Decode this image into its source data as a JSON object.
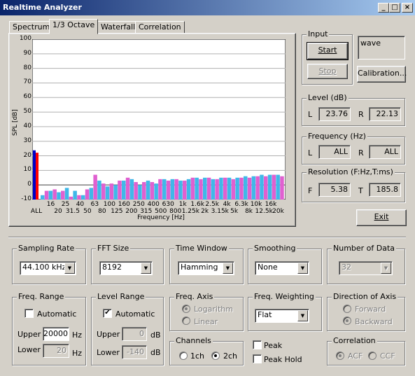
{
  "window": {
    "title": "Realtime Analyzer"
  },
  "tabs": [
    {
      "label": "Spectrum",
      "active": false
    },
    {
      "label": "1/3 Octave",
      "active": true
    },
    {
      "label": "Waterfall",
      "active": false
    },
    {
      "label": "Correlation",
      "active": false
    }
  ],
  "chart_data": {
    "type": "bar",
    "ylabel": "SPL [dB]",
    "xlabel": "Frequency [Hz]",
    "ylim": [
      -10,
      100
    ],
    "yticks": [
      100,
      90,
      80,
      70,
      60,
      50,
      40,
      30,
      20,
      10,
      0,
      -10
    ],
    "xticks_row1": [
      "16",
      "25",
      "40",
      "63",
      "100",
      "160",
      "250",
      "400",
      "630",
      "1k",
      "1.6k",
      "2.5k",
      "4k",
      "6.3k",
      "10k",
      "16k"
    ],
    "xticks_row2": [
      "ALL",
      "20",
      "31.5",
      "50",
      "80",
      "125",
      "200",
      "315",
      "500",
      "800",
      "1.25k",
      "2k",
      "3.15k",
      "5k",
      "8k",
      "12.5k",
      "20k"
    ],
    "all_bars": {
      "L": 23.76,
      "R": 22.13,
      "colors": [
        "#0000c8",
        "#ff0000"
      ]
    },
    "series": [
      {
        "color": "#40b8e8",
        "values": [
          -7,
          -4,
          -5,
          -2,
          -4,
          -7,
          -2,
          3,
          -1,
          0,
          3,
          4,
          0,
          3,
          1,
          4,
          4,
          3,
          4,
          5,
          5,
          4,
          5,
          5,
          5,
          6,
          6,
          7,
          7,
          7
        ]
      },
      {
        "color": "#e060d0",
        "values": [
          -4,
          -3,
          -4,
          -8,
          -7,
          -3,
          7,
          1,
          1,
          3,
          5,
          2,
          2,
          2,
          4,
          3,
          4,
          3,
          5,
          4,
          5,
          4,
          5,
          4,
          5,
          5,
          6,
          6,
          7,
          6
        ]
      }
    ]
  },
  "input": {
    "label": "Input",
    "start": "Start",
    "stop": "Stop",
    "source": "wave",
    "calibration": "Calibration..."
  },
  "level": {
    "label": "Level (dB)",
    "l_label": "L",
    "l_value": "23.76",
    "r_label": "R",
    "r_value": "22.13"
  },
  "frequency": {
    "label": "Frequency (Hz)",
    "l_label": "L",
    "l_value": "ALL",
    "r_label": "R",
    "r_value": "ALL"
  },
  "resolution": {
    "label": "Resolution (F:Hz,T:ms)",
    "f_label": "F",
    "f_value": "5.38",
    "t_label": "T",
    "t_value": "185.8"
  },
  "exit": "Exit",
  "sampling_rate": {
    "label": "Sampling Rate",
    "value": "44.100 kHz"
  },
  "fft_size": {
    "label": "FFT Size",
    "value": "8192"
  },
  "time_window": {
    "label": "Time Window",
    "value": "Hamming"
  },
  "smoothing": {
    "label": "Smoothing",
    "value": "None"
  },
  "number_of_data": {
    "label": "Number of Data",
    "value": "32"
  },
  "freq_range": {
    "label": "Freq. Range",
    "automatic": "Automatic",
    "upper_label": "Upper",
    "upper_value": "20000",
    "upper_unit": "Hz",
    "lower_label": "Lower",
    "lower_value": "20",
    "lower_unit": "Hz"
  },
  "level_range": {
    "label": "Level Range",
    "automatic": "Automatic",
    "upper_label": "Upper",
    "upper_value": "0",
    "upper_unit": "dB",
    "lower_label": "Lower",
    "lower_value": "-140",
    "lower_unit": "dB"
  },
  "freq_axis": {
    "label": "Freq. Axis",
    "opt1": "Logarithm",
    "opt2": "Linear"
  },
  "freq_weighting": {
    "label": "Freq. Weighting",
    "value": "Flat"
  },
  "direction_axis": {
    "label": "Direction of Axis",
    "opt1": "Forward",
    "opt2": "Backward"
  },
  "channels": {
    "label": "Channels",
    "opt1": "1ch",
    "opt2": "2ch"
  },
  "peak": {
    "peak": "Peak",
    "peak_hold": "Peak Hold"
  },
  "correlation": {
    "label": "Correlation",
    "opt1": "ACF",
    "opt2": "CCF"
  }
}
